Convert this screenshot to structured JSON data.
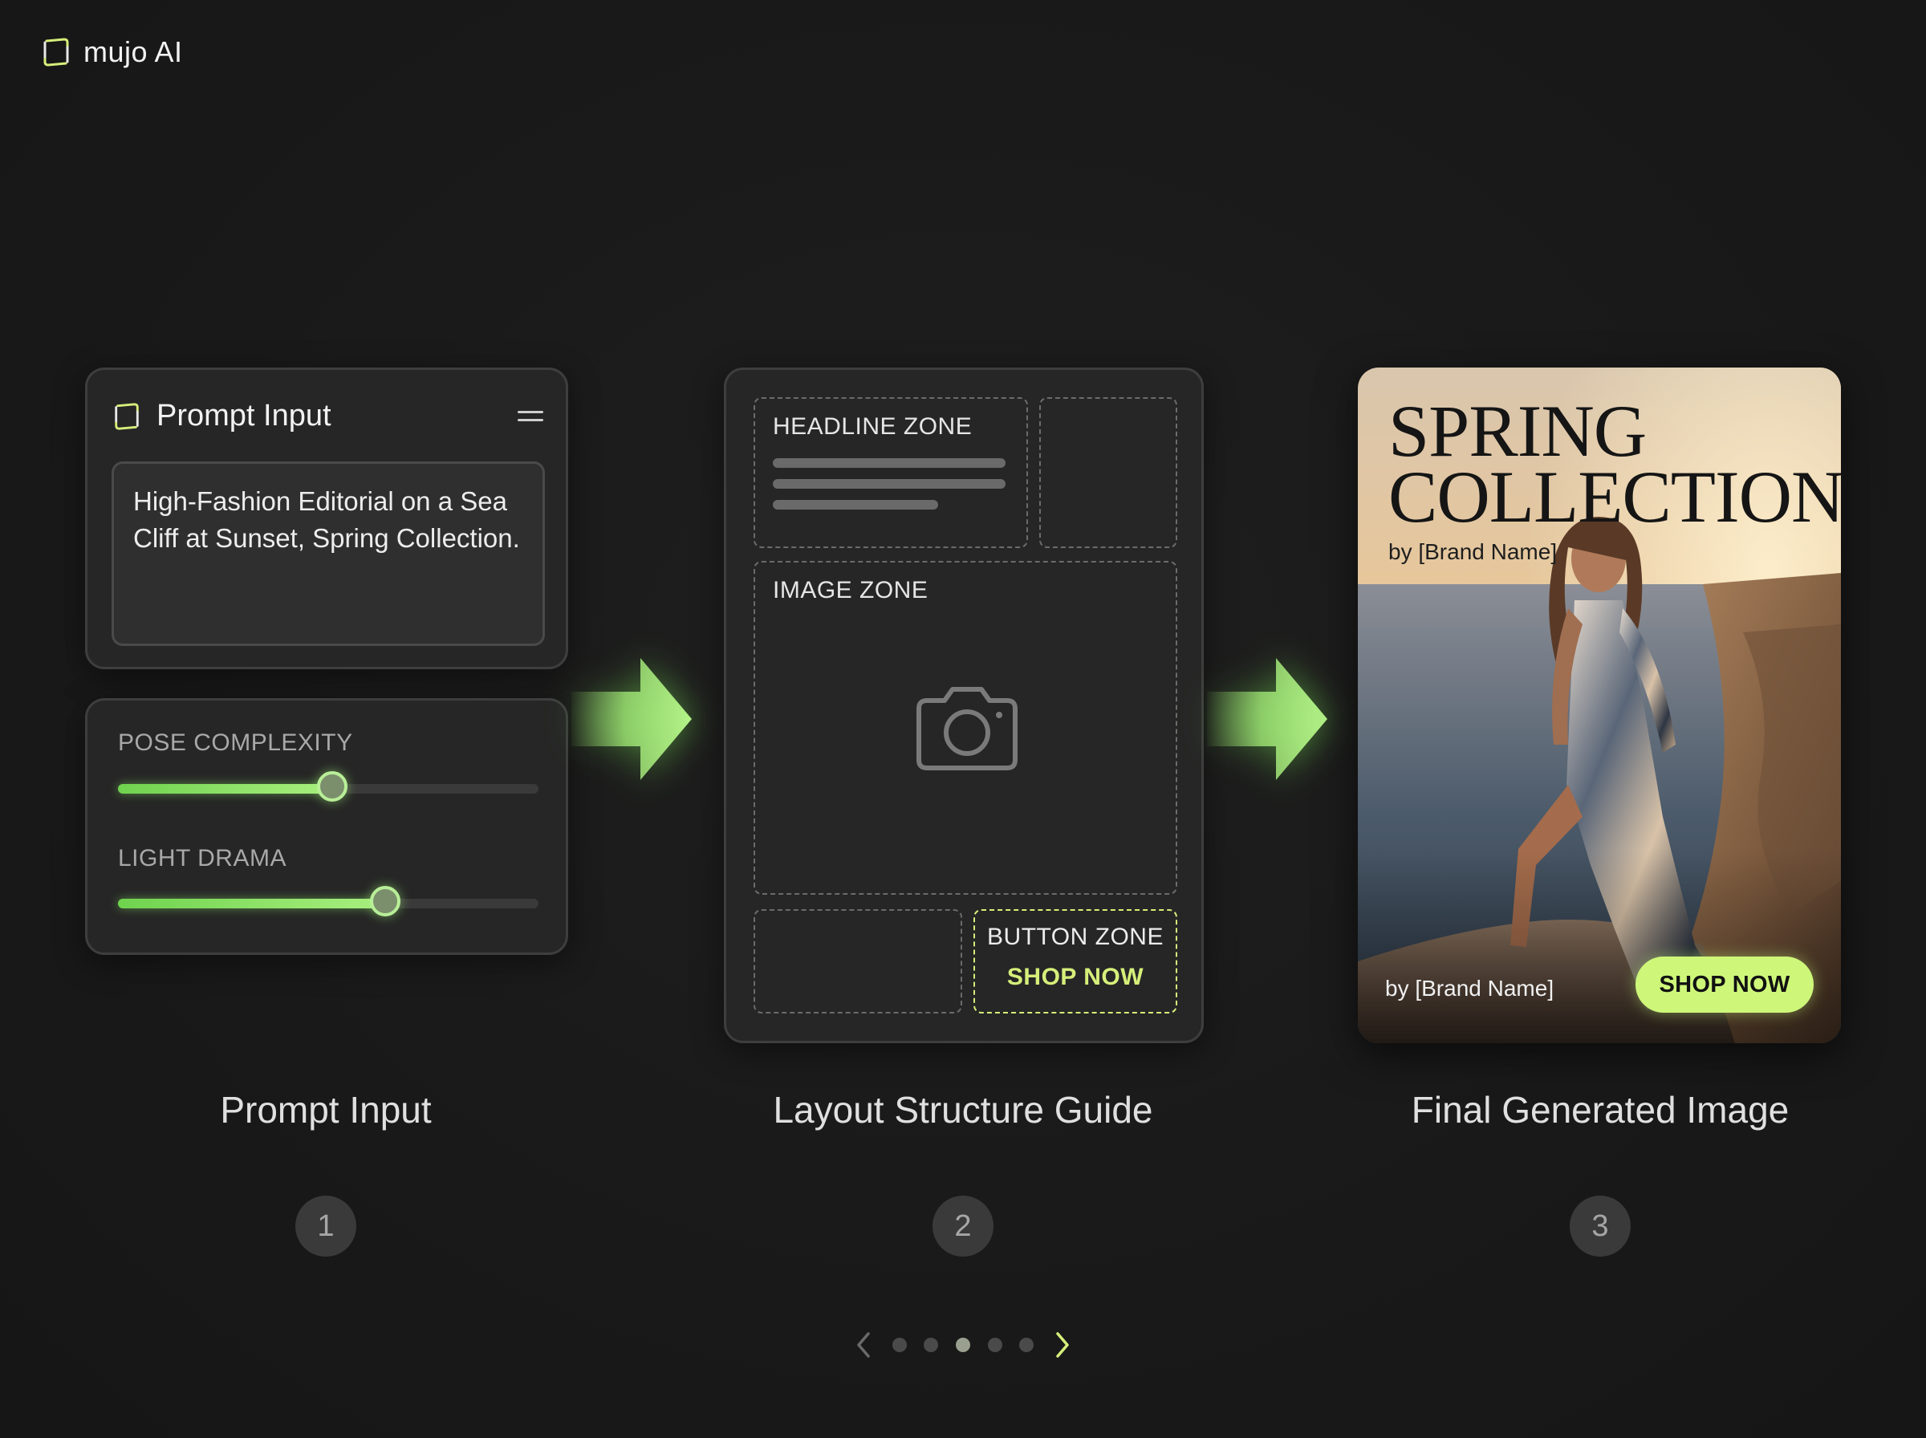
{
  "brand": {
    "name": "mujo AI",
    "icon": "square-bracket-logo-icon",
    "accent": "#d6ef7a"
  },
  "prompt_panel": {
    "title": "Prompt Input",
    "text": "High-Fashion Editorial on a Sea Cliff at Sunset, Spring Collection.",
    "menu_icon": "hamburger-icon"
  },
  "sliders": [
    {
      "label": "POSE COMPLEXITY",
      "value": 0.51
    },
    {
      "label": "LIGHT DRAMA",
      "value": 0.636
    }
  ],
  "layout_guide": {
    "headline_zone": "HEADLINE ZONE",
    "image_zone": "IMAGE ZONE",
    "button_zone": "BUTTON ZONE",
    "button_text": "SHOP NOW",
    "camera_icon": "camera-icon"
  },
  "final_image": {
    "title_line1": "SPRING",
    "title_line2": "COLLECTION",
    "brand_top": "by [Brand Name]",
    "brand_bottom": "by [Brand Name]",
    "cta": "SHOP NOW",
    "cta_color": "#cef77a"
  },
  "steps": [
    {
      "caption": "Prompt Input",
      "number": "1"
    },
    {
      "caption": "Layout Structure Guide",
      "number": "2"
    },
    {
      "caption": "Final Generated Image",
      "number": "3"
    }
  ],
  "pager": {
    "total": 5,
    "active_index": 2,
    "prev_icon": "chevron-left-icon",
    "next_icon": "chevron-right-icon"
  },
  "colors": {
    "background": "#1a1a1a",
    "panel": "#262626",
    "arrow_green": "#a6ef7a",
    "slider_green": "#7fdc5a"
  }
}
